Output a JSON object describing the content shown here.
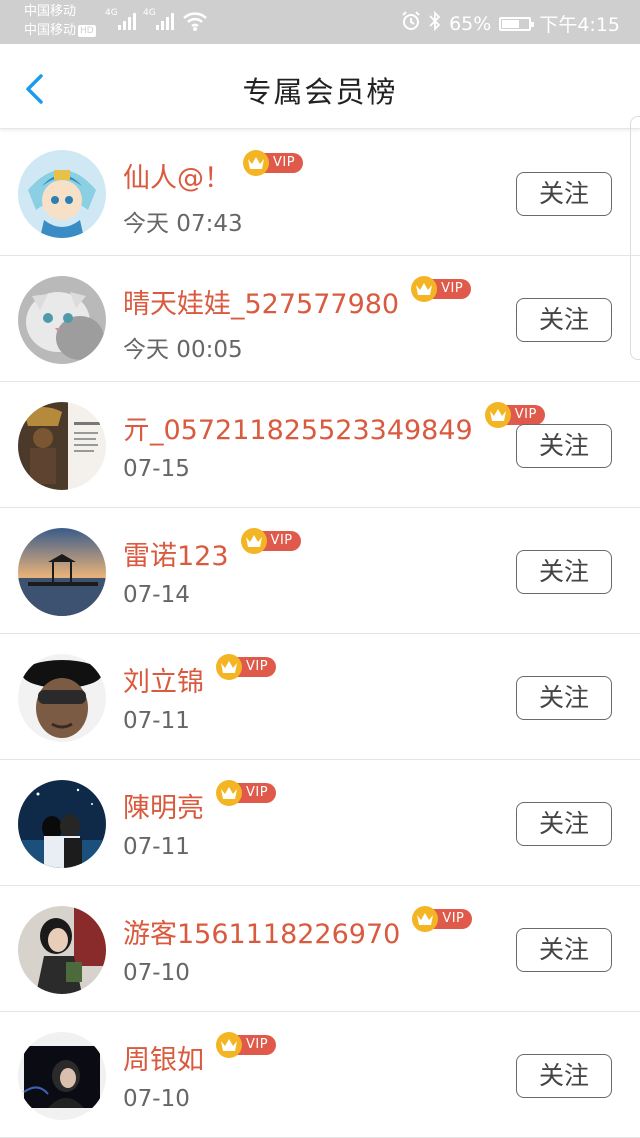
{
  "status_bar": {
    "carrier1": "中国移动",
    "carrier2": "中国移动",
    "hd": "HD",
    "net1": "4G",
    "net2": "4G",
    "battery_text": "65%",
    "battery_level": 0.65,
    "time": "下午4:15",
    "icons": [
      "alarm-icon",
      "bluetooth-icon",
      "wifi-icon",
      "battery-icon"
    ]
  },
  "header": {
    "title": "专属会员榜",
    "back_icon": "chevron-left-icon",
    "accent": "#1e9bf0"
  },
  "colors": {
    "name": "#d95a3e",
    "vip_badge": "#e05a4b",
    "crown": "#f3b523"
  },
  "vip_label": "VIP",
  "follow_label": "关注",
  "members": [
    {
      "name": "仙人@！",
      "time": "今天 07:43"
    },
    {
      "name": "晴天娃娃_527577980",
      "time": "今天 00:05"
    },
    {
      "name": "亓_057211825523349849",
      "time": "07-15"
    },
    {
      "name": "雷诺123",
      "time": "07-14"
    },
    {
      "name": "刘立锦",
      "time": "07-11"
    },
    {
      "name": "陳明亮",
      "time": "07-11"
    },
    {
      "name": "游客1561118226970",
      "time": "07-10"
    },
    {
      "name": "周银如",
      "time": "07-10"
    }
  ]
}
